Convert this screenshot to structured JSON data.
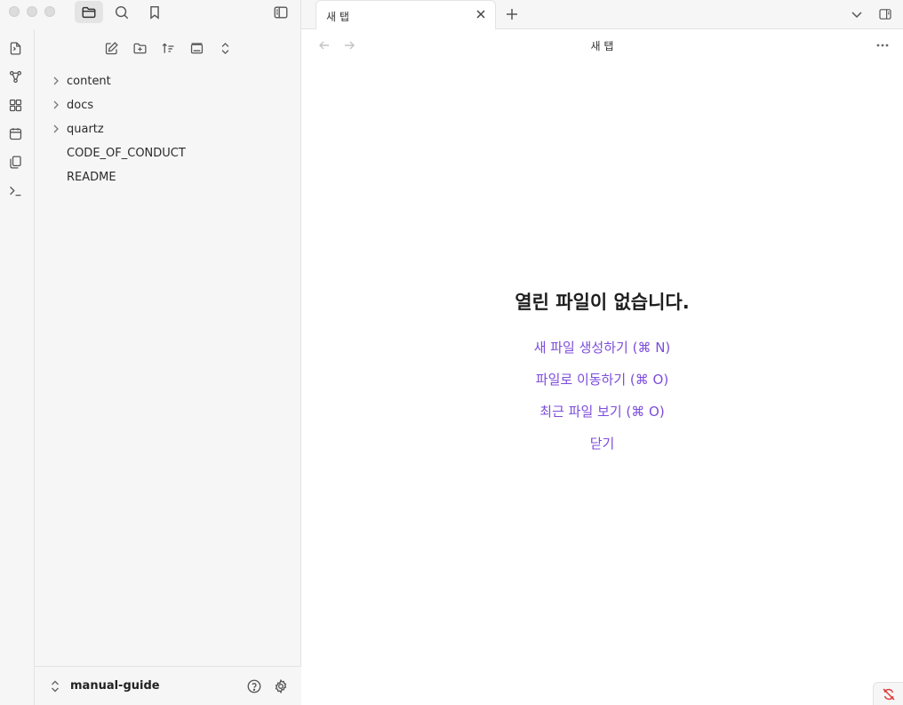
{
  "tabs": [
    {
      "title": "새 탭"
    }
  ],
  "view": {
    "title": "새 탭"
  },
  "explorer": {
    "items": [
      {
        "label": "content",
        "type": "folder"
      },
      {
        "label": "docs",
        "type": "folder"
      },
      {
        "label": "quartz",
        "type": "folder"
      },
      {
        "label": "CODE_OF_CONDUCT",
        "type": "file"
      },
      {
        "label": "README",
        "type": "file"
      }
    ]
  },
  "vault": {
    "name": "manual-guide"
  },
  "empty_state": {
    "title": "열린 파일이 없습니다.",
    "actions": {
      "new_file": "새 파일 생성하기 (⌘ N)",
      "go_to_file": "파일로 이동하기 (⌘ O)",
      "recent_files": "최근 파일 보기 (⌘ O)",
      "close": "닫기"
    }
  },
  "colors": {
    "accent": "#7c4ddb",
    "sync_error": "#e03b3b",
    "sidebar_bg": "#f6f6f6"
  },
  "icons": {
    "ribbon": [
      "file-switch-icon",
      "graph-icon",
      "canvas-icon",
      "calendar-icon",
      "copy-icon",
      "terminal-icon"
    ]
  }
}
